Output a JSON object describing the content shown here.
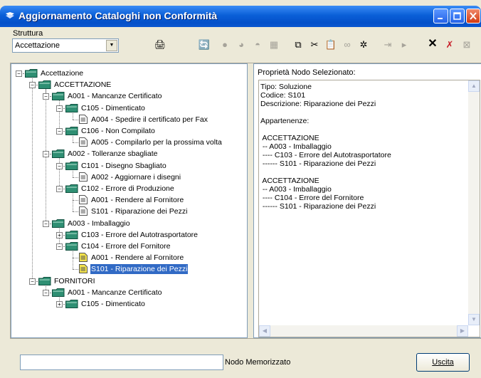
{
  "window": {
    "title": "Aggiornamento Cataloghi non Conformità"
  },
  "toolbar": {
    "struttura_label": "Struttura",
    "struttura_value": "Accettazione"
  },
  "tree": [
    {
      "label": "Accettazione",
      "depth": 0,
      "type": "folder",
      "expander": "minus"
    },
    {
      "label": "ACCETTAZIONE",
      "depth": 1,
      "type": "folder",
      "expander": "minus"
    },
    {
      "label": "A001 - Mancanze Certificato",
      "depth": 2,
      "type": "folder",
      "expander": "minus"
    },
    {
      "label": "C105 - Dimenticato",
      "depth": 3,
      "type": "folder",
      "expander": "minus"
    },
    {
      "label": "A004 - Spedire il certificato per Fax",
      "depth": 4,
      "type": "doc"
    },
    {
      "label": "C106 - Non Compilato",
      "depth": 3,
      "type": "folder",
      "expander": "minus"
    },
    {
      "label": "A005 - Compilarlo per la prossima volta",
      "depth": 4,
      "type": "doc"
    },
    {
      "label": "A002 - Tolleranze sbagliate",
      "depth": 2,
      "type": "folder",
      "expander": "minus"
    },
    {
      "label": "C101 - Disegno Sbagliato",
      "depth": 3,
      "type": "folder",
      "expander": "minus"
    },
    {
      "label": "A002 - Aggiornare i disegni",
      "depth": 4,
      "type": "doc"
    },
    {
      "label": "C102 - Errore di Produzione",
      "depth": 3,
      "type": "folder",
      "expander": "minus"
    },
    {
      "label": "A001 - Rendere al Fornitore",
      "depth": 4,
      "type": "doc"
    },
    {
      "label": "S101 - Riparazione dei Pezzi",
      "depth": 4,
      "type": "doc"
    },
    {
      "label": "A003 - Imballaggio",
      "depth": 2,
      "type": "folder",
      "expander": "minus"
    },
    {
      "label": "C103 - Errore del Autotrasportatore",
      "depth": 3,
      "type": "folder",
      "expander": "plus"
    },
    {
      "label": "C104 - Errore del Fornitore",
      "depth": 3,
      "type": "folder",
      "expander": "minus"
    },
    {
      "label": "A001 - Rendere al Fornitore",
      "depth": 4,
      "type": "doc",
      "highlight": true
    },
    {
      "label": "S101 - Riparazione dei Pezzi",
      "depth": 4,
      "type": "doc",
      "highlight": true,
      "selected": true
    },
    {
      "label": "FORNITORI",
      "depth": 1,
      "type": "folder",
      "expander": "minus"
    },
    {
      "label": "A001 - Mancanze Certificato",
      "depth": 2,
      "type": "folder",
      "expander": "minus"
    },
    {
      "label": "C105 - Dimenticato",
      "depth": 3,
      "type": "folder",
      "expander": "plus"
    }
  ],
  "properties": {
    "title": "Proprietà Nodo Selezionato:",
    "text": "Tipo: Soluzione\nCodice: S101\nDescrizione: Riparazione dei Pezzi\n\nAppartenenze:\n\n ACCETTAZIONE\n -- A003 - Imballaggio\n ---- C103 - Errore del Autotrasportatore\n ------ S101 - Riparazione dei Pezzi\n\n ACCETTAZIONE\n -- A003 - Imballaggio\n ---- C104 - Errore del Fornitore\n ------ S101 - Riparazione dei Pezzi"
  },
  "bottom": {
    "nodo_label": "Nodo Memorizzato",
    "nodo_value": "",
    "uscita_label": "Uscita"
  },
  "colors": {
    "titlebar": "#0a5fd8",
    "folder": "#2f8f73",
    "selection": "#316ac5",
    "face": "#ece9d8"
  }
}
